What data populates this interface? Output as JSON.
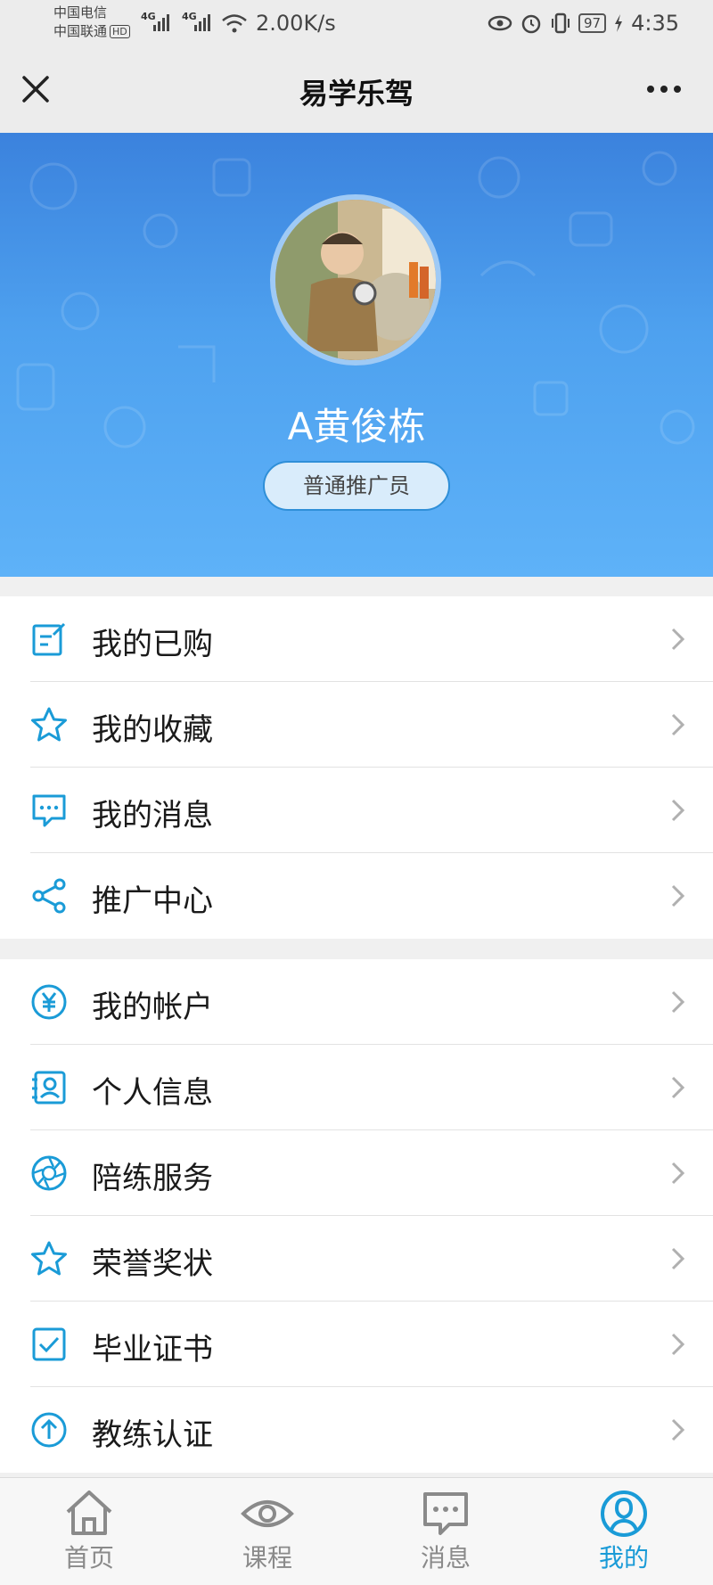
{
  "status_bar": {
    "carrier1": "中国电信",
    "carrier2": "中国联通",
    "hd": "HD",
    "net1": "4G",
    "net2": "4G",
    "speed": "2.00K/s",
    "battery": "97",
    "time": "4:35"
  },
  "titlebar": {
    "title": "易学乐驾"
  },
  "profile": {
    "name": "A黄俊栋",
    "role": "普通推广员"
  },
  "menu_group1": [
    {
      "label": "我的已购",
      "icon": "edit-note-icon"
    },
    {
      "label": "我的收藏",
      "icon": "star-icon"
    },
    {
      "label": "我的消息",
      "icon": "chat-bubble-icon"
    },
    {
      "label": "推广中心",
      "icon": "share-icon"
    }
  ],
  "menu_group2": [
    {
      "label": "我的帐户",
      "icon": "yen-icon"
    },
    {
      "label": "个人信息",
      "icon": "contact-card-icon"
    },
    {
      "label": "陪练服务",
      "icon": "aperture-icon"
    },
    {
      "label": "荣誉奖状",
      "icon": "star-icon"
    },
    {
      "label": "毕业证书",
      "icon": "checkbox-icon"
    },
    {
      "label": "教练认证",
      "icon": "upload-circle-icon"
    }
  ],
  "bottom_nav": [
    {
      "label": "首页",
      "icon": "home-icon",
      "active": false
    },
    {
      "label": "课程",
      "icon": "eye-icon",
      "active": false
    },
    {
      "label": "消息",
      "icon": "message-icon",
      "active": false
    },
    {
      "label": "我的",
      "icon": "user-icon",
      "active": true
    }
  ],
  "colors": {
    "accent": "#1a9bd7",
    "header_blue": "#4ea1ef",
    "inactive": "#8a8a8a"
  }
}
